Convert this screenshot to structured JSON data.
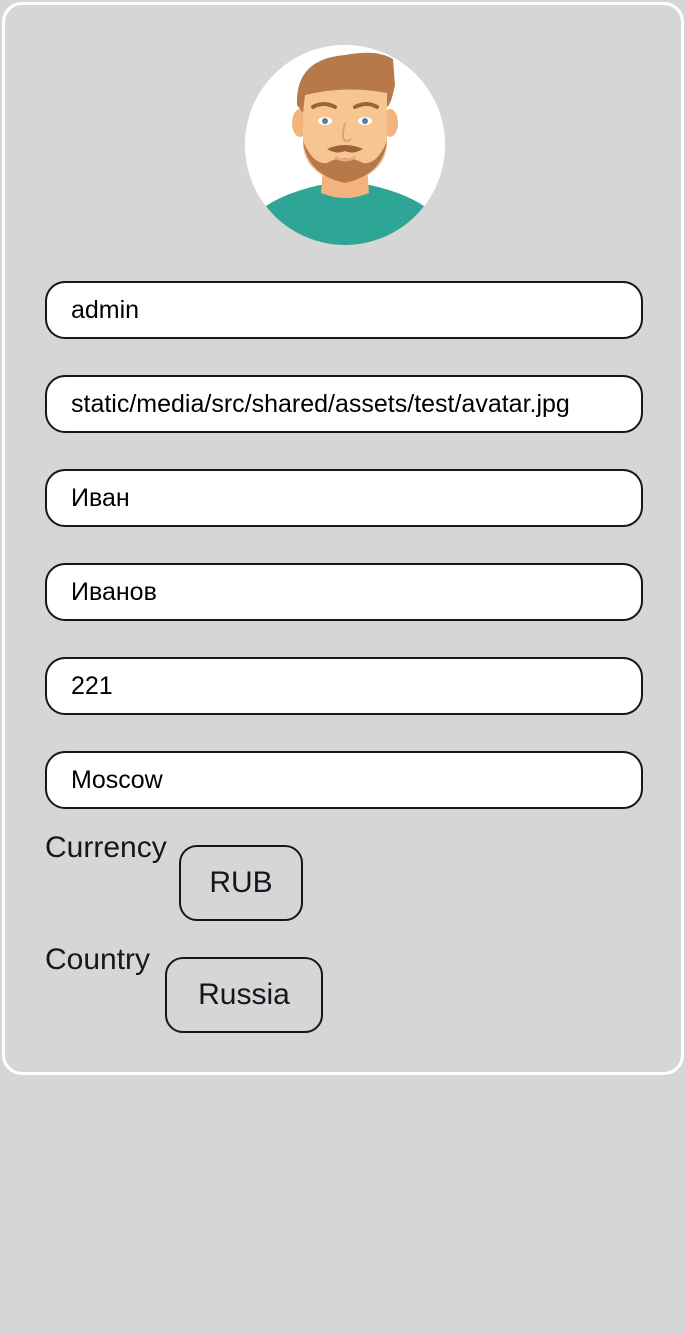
{
  "profile": {
    "avatar_alt": "avatar",
    "fields": [
      {
        "name": "username-input",
        "value": "admin"
      },
      {
        "name": "avatar-url-input",
        "value": "static/media/src/shared/assets/test/avatar.jpg"
      },
      {
        "name": "first-name-input",
        "value": "Иван"
      },
      {
        "name": "last-name-input",
        "value": "Иванов"
      },
      {
        "name": "age-input",
        "value": "221"
      },
      {
        "name": "city-input",
        "value": "Moscow"
      }
    ],
    "currency": {
      "label": "Currency",
      "value": "RUB"
    },
    "country": {
      "label": "Country",
      "value": "Russia"
    }
  },
  "colors": {
    "background": "#d6d6d6",
    "border": "#16161f",
    "card_border": "#ffffff",
    "input_bg": "#ffffff",
    "shirt": "#2fa596",
    "hair": "#b8794a",
    "skin": "#f7c592"
  }
}
